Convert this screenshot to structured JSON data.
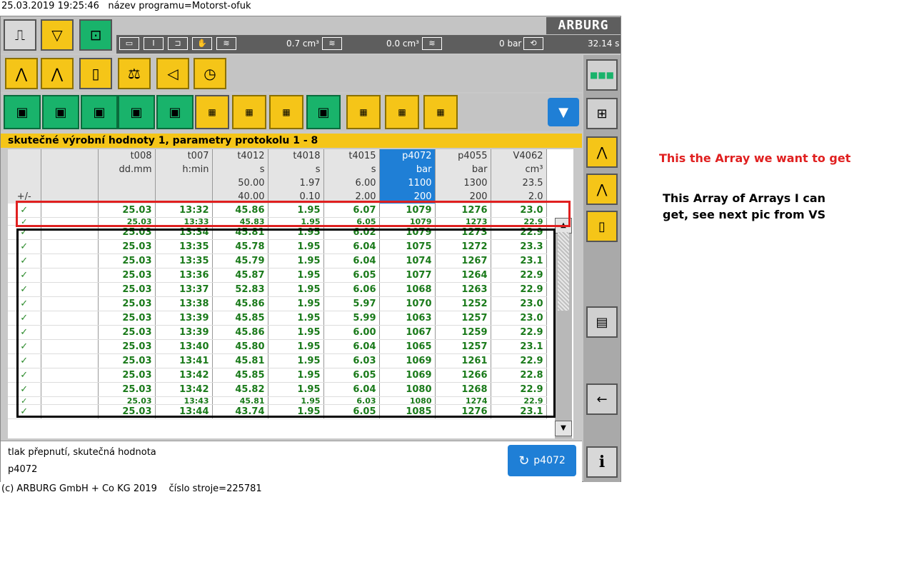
{
  "top_status": "25.03.2019 19:25:46   název programu=Motorst-ofuk",
  "bottom_status": "(c) ARBURG GmbH + Co KG 2019    číslo stroje=225781",
  "logo": "ARBURG",
  "statusbar": {
    "volume1": "0.7 cm³",
    "volume2": "0.0 cm³",
    "pressure": "0 bar",
    "cycle_time": "32.14 s"
  },
  "band_title": "skutečné výrobní hodnoty 1, parametry protokolu 1 - 8",
  "table": {
    "headers_code": [
      "",
      "",
      "t008",
      "t007",
      "t4012",
      "t4018",
      "t4015",
      "p4072",
      "p4055",
      "V4062"
    ],
    "headers_unit": [
      "",
      "",
      "dd.mm",
      "h:min",
      "s",
      "s",
      "s",
      "bar",
      "bar",
      "cm³"
    ],
    "headers_max": [
      "",
      "",
      "",
      "",
      "50.00",
      "1.97",
      "6.00",
      "1100",
      "1300",
      "23.5"
    ],
    "headers_min": [
      "+/-",
      "",
      "",
      "",
      "40.00",
      "0.10",
      "2.00",
      "200",
      "200",
      "2.0"
    ],
    "rows": [
      [
        "✓",
        "",
        "25.03",
        "13:32",
        "45.86",
        "1.95",
        "6.07",
        "1079",
        "1276",
        "23.0"
      ],
      [
        "✓",
        "",
        "25.03",
        "13:33",
        "45.83",
        "1.95",
        "6.05",
        "1079",
        "1273",
        "22.9"
      ],
      [
        "✓",
        "",
        "25.03",
        "13:34",
        "45.81",
        "1.95",
        "6.02",
        "1079",
        "1273",
        "22.9"
      ],
      [
        "✓",
        "",
        "25.03",
        "13:35",
        "45.78",
        "1.95",
        "6.04",
        "1075",
        "1272",
        "23.3"
      ],
      [
        "✓",
        "",
        "25.03",
        "13:35",
        "45.79",
        "1.95",
        "6.04",
        "1074",
        "1267",
        "23.1"
      ],
      [
        "✓",
        "",
        "25.03",
        "13:36",
        "45.87",
        "1.95",
        "6.05",
        "1077",
        "1264",
        "22.9"
      ],
      [
        "✓",
        "",
        "25.03",
        "13:37",
        "52.83",
        "1.95",
        "6.06",
        "1068",
        "1263",
        "22.9"
      ],
      [
        "✓",
        "",
        "25.03",
        "13:38",
        "45.86",
        "1.95",
        "5.97",
        "1070",
        "1252",
        "23.0"
      ],
      [
        "✓",
        "",
        "25.03",
        "13:39",
        "45.85",
        "1.95",
        "5.99",
        "1063",
        "1257",
        "23.0"
      ],
      [
        "✓",
        "",
        "25.03",
        "13:39",
        "45.86",
        "1.95",
        "6.00",
        "1067",
        "1259",
        "22.9"
      ],
      [
        "✓",
        "",
        "25.03",
        "13:40",
        "45.80",
        "1.95",
        "6.04",
        "1065",
        "1257",
        "23.1"
      ],
      [
        "✓",
        "",
        "25.03",
        "13:41",
        "45.81",
        "1.95",
        "6.03",
        "1069",
        "1261",
        "22.9"
      ],
      [
        "✓",
        "",
        "25.03",
        "13:42",
        "45.85",
        "1.95",
        "6.05",
        "1069",
        "1266",
        "22.8"
      ],
      [
        "✓",
        "",
        "25.03",
        "13:42",
        "45.82",
        "1.95",
        "6.04",
        "1080",
        "1268",
        "22.9"
      ],
      [
        "✓",
        "",
        "25.03",
        "13:43",
        "45.81",
        "1.95",
        "6.03",
        "1080",
        "1274",
        "22.9"
      ],
      [
        "✓",
        "",
        "25.03",
        "13:44",
        "43.74",
        "1.95",
        "6.05",
        "1085",
        "1276",
        "23.1"
      ]
    ]
  },
  "info": {
    "line1": "tlak přepnutí, skutečná hodnota",
    "line2": "p4072"
  },
  "p4072_button": "p4072",
  "info_button": "i",
  "annotations": {
    "note_red": "This the Array we want to get",
    "note_black": "This Array of Arrays I can get, see next pic from VS"
  },
  "colors": {
    "yellow": "#f5c518",
    "green": "#19b36b",
    "blue": "#1f7fd6",
    "value_green": "#1a7a1a",
    "annotation_red": "#e02020"
  }
}
